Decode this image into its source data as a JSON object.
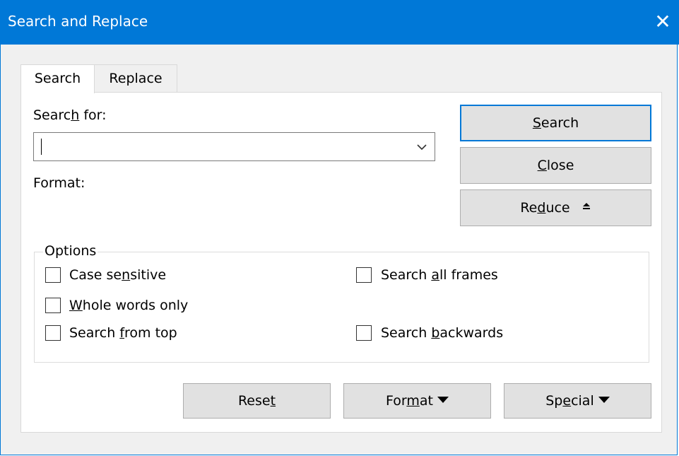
{
  "window": {
    "title": "Search and Replace",
    "close_glyph": "✕"
  },
  "tabs": [
    {
      "label": "Search",
      "active": true
    },
    {
      "label": "Replace",
      "active": false
    }
  ],
  "search": {
    "label_before": "Searc",
    "label_mnemonic": "h",
    "label_after": " for:",
    "value": "",
    "format_label": "Format:"
  },
  "actions": {
    "search": {
      "mnemonic": "S",
      "rest": "earch"
    },
    "close": {
      "mnemonic": "C",
      "rest": "lose"
    },
    "reduce": {
      "before": "Re",
      "mnemonic": "d",
      "after": "uce"
    }
  },
  "options": {
    "legend": "Options",
    "case_sensitive": {
      "before": "Case se",
      "mnemonic": "n",
      "after": "sitive",
      "checked": false
    },
    "whole_words": {
      "before": "",
      "mnemonic": "W",
      "after": "hole words only",
      "checked": false
    },
    "from_top": {
      "before": "Search ",
      "mnemonic": "f",
      "after": "rom top",
      "checked": false
    },
    "all_frames": {
      "before": "Search ",
      "mnemonic": "a",
      "after": "ll frames",
      "checked": false
    },
    "backwards": {
      "before": "Search ",
      "mnemonic": "b",
      "after": "ackwards",
      "checked": false
    }
  },
  "footer": {
    "reset": {
      "before": "Rese",
      "mnemonic": "t",
      "after": ""
    },
    "format": {
      "before": "For",
      "mnemonic": "m",
      "after": "at"
    },
    "special": {
      "before": "Sp",
      "mnemonic": "e",
      "after": "cial"
    }
  },
  "colors": {
    "titlebar": "#0078d7",
    "dialog_bg": "#f0f0f0",
    "button_bg": "#e1e1e1",
    "focus_border": "#0078d7"
  },
  "icons": {
    "close": "close-icon",
    "dropdown": "chevron-down-icon",
    "reduce": "collapse-up-icon",
    "menu": "triangle-down-icon"
  }
}
